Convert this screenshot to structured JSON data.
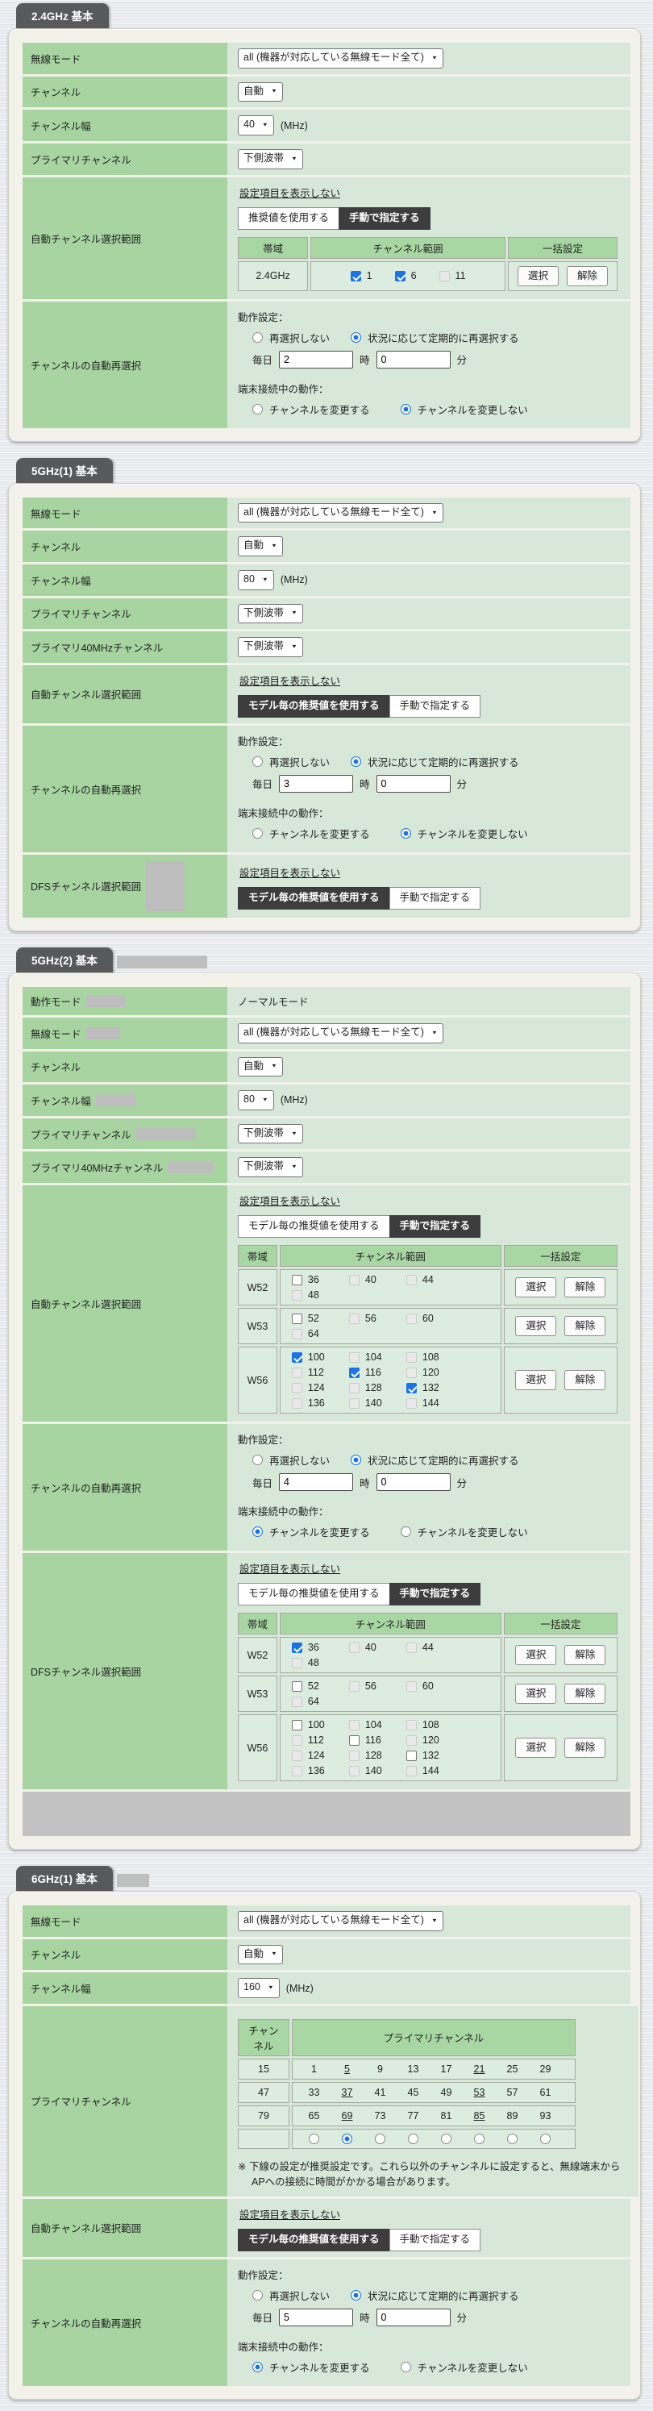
{
  "common": {
    "hide_link": "設定項目を表示しない",
    "use_recommended": "推奨値を使用する",
    "use_model_recommended": "モデル毎の推奨値を使用する",
    "manual": "手動で指定する",
    "band_header": "帯域",
    "range_header": "チャンネル範囲",
    "bulk_header": "一括設定",
    "select_btn": "選択",
    "clear_btn": "解除",
    "op_label": "動作設定：",
    "no_reselect": "再選択しない",
    "periodic_reselect": "状況に応じて定期的に再選択する",
    "daily": "毎日",
    "hour_unit": "時",
    "minute_unit": "分",
    "connected_label": "端末接続中の動作：",
    "change_channel": "チャンネルを変更する",
    "keep_channel": "チャンネルを変更しない",
    "mhz": "(MHz)",
    "colors": {
      "accent_green": "#a7d4a1",
      "pale_green": "#d7e8d9",
      "tab_gray": "#58595a",
      "check_blue": "#1a73e8"
    }
  },
  "sections": [
    {
      "id": "2-4ghz",
      "title": "2.4GHz 基本",
      "rows": [
        {
          "type": "select",
          "name": "wireless-mode",
          "label": "無線モード",
          "value": "all (機器が対応している無線モード全て)"
        },
        {
          "type": "select",
          "name": "channel",
          "label": "チャンネル",
          "value": "自動"
        },
        {
          "type": "select",
          "name": "channel-width",
          "label": "チャンネル幅",
          "value": "40",
          "suffix": "(MHz)"
        },
        {
          "type": "select",
          "name": "primary-channel",
          "label": "プライマリチャンネル",
          "value": "下側波帯"
        },
        {
          "type": "range",
          "name": "auto-channel-range",
          "label": "自動チャンネル選択範囲",
          "buttons": [
            {
              "key": "use_recommended",
              "active": false
            },
            {
              "key": "manual",
              "active": true
            }
          ],
          "table": {
            "style": "wide",
            "center": true,
            "rows": [
              {
                "band": "2.4GHz",
                "cells": [
                  {
                    "v": "1",
                    "state": "checked"
                  },
                  {
                    "v": "6",
                    "state": "checked"
                  },
                  {
                    "v": "11",
                    "state": "dis"
                  }
                ]
              }
            ]
          }
        },
        {
          "type": "reselect",
          "name": "channel-auto-reselect",
          "label": "チャンネルの自動再選択",
          "hour": "2",
          "minute": "0",
          "mode": "periodic",
          "connected": "keep"
        }
      ]
    },
    {
      "id": "5ghz-1",
      "title": "5GHz(1) 基本",
      "rows": [
        {
          "type": "select",
          "name": "wireless-mode",
          "label": "無線モード",
          "value": "all (機器が対応している無線モード全て)"
        },
        {
          "type": "select",
          "name": "channel",
          "label": "チャンネル",
          "value": "自動"
        },
        {
          "type": "select",
          "name": "channel-width",
          "label": "チャンネル幅",
          "value": "80",
          "suffix": "(MHz)"
        },
        {
          "type": "select",
          "name": "primary-channel",
          "label": "プライマリチャンネル",
          "value": "下側波帯"
        },
        {
          "type": "select",
          "name": "primary-40mhz-channel",
          "label": "プライマリ40MHzチャンネル",
          "value": "下側波帯"
        },
        {
          "type": "range",
          "name": "auto-channel-range",
          "label": "自動チャンネル選択範囲",
          "buttons": [
            {
              "key": "use_model_recommended",
              "active": true
            },
            {
              "key": "manual",
              "active": false
            }
          ]
        },
        {
          "type": "reselect",
          "name": "channel-auto-reselect",
          "label": "チャンネルの自動再選択",
          "hour": "3",
          "minute": "0",
          "mode": "periodic",
          "connected": "keep"
        },
        {
          "type": "range",
          "name": "dfs-channel-range",
          "label": "DFSチャンネル選択範囲",
          "label_redact_block": {
            "w": 48,
            "h": 62
          },
          "buttons": [
            {
              "key": "use_model_recommended",
              "active": true
            },
            {
              "key": "manual",
              "active": false
            }
          ]
        }
      ]
    },
    {
      "id": "5ghz-2",
      "title": "5GHz(2) 基本",
      "title_redact": {
        "w": 112,
        "h": 16
      },
      "rows": [
        {
          "type": "text",
          "name": "operation-mode",
          "label": "動作モード",
          "label_redact": {
            "w": 48,
            "h": 15
          },
          "value": "ノーマルモード"
        },
        {
          "type": "select",
          "name": "wireless-mode",
          "label": "無線モード",
          "label_redact": {
            "w": 42,
            "h": 15
          },
          "value": "all (機器が対応している無線モード全て)"
        },
        {
          "type": "select",
          "name": "channel",
          "label": "チャンネル",
          "value": "自動"
        },
        {
          "type": "select",
          "name": "channel-width",
          "label": "チャンネル幅",
          "label_redact": {
            "w": 50,
            "h": 15
          },
          "value": "80",
          "suffix": "(MHz)"
        },
        {
          "type": "select",
          "name": "primary-channel",
          "label": "プライマリチャンネル",
          "label_redact": {
            "w": 74,
            "h": 15
          },
          "value": "下側波帯"
        },
        {
          "type": "select",
          "name": "primary-40mhz-channel",
          "label": "プライマリ40MHzチャンネル",
          "label_redact": {
            "w": 56,
            "h": 15
          },
          "value": "下側波帯"
        },
        {
          "type": "range",
          "name": "auto-channel-range",
          "label": "自動チャンネル選択範囲",
          "buttons": [
            {
              "key": "use_model_recommended",
              "active": false
            },
            {
              "key": "manual",
              "active": true
            }
          ],
          "table": {
            "style": "narrow",
            "rows": [
              {
                "band": "W52",
                "cells": [
                  {
                    "v": "36",
                    "state": "off"
                  },
                  {
                    "v": "40",
                    "state": "dis"
                  },
                  {
                    "v": "44",
                    "state": "dis"
                  },
                  {
                    "v": "48",
                    "state": "dis"
                  }
                ]
              },
              {
                "band": "W53",
                "cells": [
                  {
                    "v": "52",
                    "state": "off"
                  },
                  {
                    "v": "56",
                    "state": "dis"
                  },
                  {
                    "v": "60",
                    "state": "dis"
                  },
                  {
                    "v": "64",
                    "state": "dis"
                  }
                ]
              },
              {
                "band": "W56",
                "cells": [
                  {
                    "v": "100",
                    "state": "checked"
                  },
                  {
                    "v": "104",
                    "state": "dis"
                  },
                  {
                    "v": "108",
                    "state": "dis"
                  },
                  {
                    "v": "112",
                    "state": "dis"
                  },
                  {
                    "v": "116",
                    "state": "checked"
                  },
                  {
                    "v": "120",
                    "state": "dis"
                  },
                  {
                    "v": "124",
                    "state": "dis"
                  },
                  {
                    "v": "128",
                    "state": "dis"
                  },
                  {
                    "v": "132",
                    "state": "checked"
                  },
                  {
                    "v": "136",
                    "state": "dis"
                  },
                  {
                    "v": "140",
                    "state": "dis"
                  },
                  {
                    "v": "144",
                    "state": "dis"
                  }
                ]
              }
            ]
          }
        },
        {
          "type": "reselect",
          "name": "channel-auto-reselect",
          "label": "チャンネルの自動再選択",
          "hour": "4",
          "minute": "0",
          "mode": "periodic",
          "connected": "change"
        },
        {
          "type": "range",
          "name": "dfs-channel-range",
          "label": "DFSチャンネル選択範囲",
          "buttons": [
            {
              "key": "use_model_recommended",
              "active": false
            },
            {
              "key": "manual",
              "active": true
            }
          ],
          "table": {
            "style": "narrow",
            "rows": [
              {
                "band": "W52",
                "cells": [
                  {
                    "v": "36",
                    "state": "checked"
                  },
                  {
                    "v": "40",
                    "state": "dis"
                  },
                  {
                    "v": "44",
                    "state": "dis"
                  },
                  {
                    "v": "48",
                    "state": "dis"
                  }
                ]
              },
              {
                "band": "W53",
                "cells": [
                  {
                    "v": "52",
                    "state": "off"
                  },
                  {
                    "v": "56",
                    "state": "dis"
                  },
                  {
                    "v": "60",
                    "state": "dis"
                  },
                  {
                    "v": "64",
                    "state": "dis"
                  }
                ]
              },
              {
                "band": "W56",
                "cells": [
                  {
                    "v": "100",
                    "state": "off"
                  },
                  {
                    "v": "104",
                    "state": "dis"
                  },
                  {
                    "v": "108",
                    "state": "dis"
                  },
                  {
                    "v": "112",
                    "state": "dis"
                  },
                  {
                    "v": "116",
                    "state": "off"
                  },
                  {
                    "v": "120",
                    "state": "dis"
                  },
                  {
                    "v": "124",
                    "state": "dis"
                  },
                  {
                    "v": "128",
                    "state": "dis"
                  },
                  {
                    "v": "132",
                    "state": "off"
                  },
                  {
                    "v": "136",
                    "state": "dis"
                  },
                  {
                    "v": "140",
                    "state": "dis"
                  },
                  {
                    "v": "144",
                    "state": "dis"
                  }
                ]
              }
            ]
          }
        },
        {
          "type": "redactbar",
          "name": "redacted-area",
          "h": 55
        }
      ]
    },
    {
      "id": "6ghz-1",
      "title": "6GHz(1) 基本",
      "title_redact": {
        "w": 40,
        "h": 16
      },
      "rows": [
        {
          "type": "select",
          "name": "wireless-mode",
          "label": "無線モード",
          "value": "all (機器が対応している無線モード全て)"
        },
        {
          "type": "select",
          "name": "channel",
          "label": "チャンネル",
          "value": "自動"
        },
        {
          "type": "select",
          "name": "channel-width",
          "label": "チャンネル幅",
          "value": "160",
          "suffix": "(MHz)"
        },
        {
          "type": "primary",
          "name": "primary-channel-table",
          "label": "プライマリチャンネル",
          "ch_header": "チャンネル",
          "primary_header": "プライマリチャンネル",
          "groups": [
            {
              "ch": "15",
              "cells": [
                {
                  "v": "1"
                },
                {
                  "v": "5",
                  "rec": true
                },
                {
                  "v": "9"
                },
                {
                  "v": "13"
                },
                {
                  "v": "17"
                },
                {
                  "v": "21",
                  "rec": true
                },
                {
                  "v": "25"
                },
                {
                  "v": "29"
                }
              ]
            },
            {
              "ch": "47",
              "cells": [
                {
                  "v": "33"
                },
                {
                  "v": "37",
                  "rec": true
                },
                {
                  "v": "41"
                },
                {
                  "v": "45"
                },
                {
                  "v": "49"
                },
                {
                  "v": "53",
                  "rec": true
                },
                {
                  "v": "57"
                },
                {
                  "v": "61"
                }
              ]
            },
            {
              "ch": "79",
              "cells": [
                {
                  "v": "65"
                },
                {
                  "v": "69",
                  "rec": true
                },
                {
                  "v": "73"
                },
                {
                  "v": "77"
                },
                {
                  "v": "81"
                },
                {
                  "v": "85",
                  "rec": true
                },
                {
                  "v": "89"
                },
                {
                  "v": "93"
                }
              ]
            }
          ],
          "selected_radio": 1,
          "note": "※ 下線の設定が推奨設定です。これら以外のチャンネルに設定すると、無線端末からAPへの接続に時間がかかる場合があります。"
        },
        {
          "type": "range",
          "name": "auto-channel-range",
          "label": "自動チャンネル選択範囲",
          "buttons": [
            {
              "key": "use_model_recommended",
              "active": true
            },
            {
              "key": "manual",
              "active": false
            }
          ]
        },
        {
          "type": "reselect",
          "name": "channel-auto-reselect",
          "label": "チャンネルの自動再選択",
          "hour": "5",
          "minute": "0",
          "mode": "periodic",
          "connected": "change"
        }
      ]
    }
  ]
}
